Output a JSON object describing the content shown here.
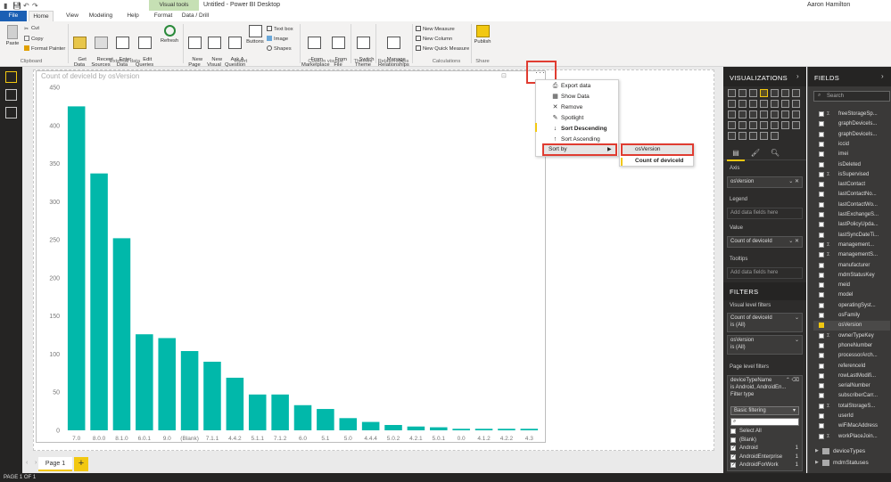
{
  "window": {
    "visual_tools_label": "Visual tools",
    "title": "Untitled - Power BI Desktop",
    "user": "Aaron Hamilton"
  },
  "tabs": [
    "File",
    "Home",
    "View",
    "Modeling",
    "Help",
    "Format",
    "Data / Drill"
  ],
  "ribbon": {
    "paste": "Paste",
    "cut": "Cut",
    "copy": "Copy",
    "format_painter": "Format Painter",
    "get_data": "Get\nData",
    "recent_sources": "Recent\nSources",
    "enter_data": "Enter\nData",
    "edit_queries": "Edit\nQueries",
    "refresh": "Refresh",
    "new_page": "New\nPage",
    "new_visual": "New\nVisual",
    "ask_question": "Ask A\nQuestion",
    "buttons": "Buttons",
    "text_box": "Text box",
    "image": "Image",
    "shapes": "Shapes",
    "from_marketplace": "From\nMarketplace",
    "from_file": "From\nFile",
    "switch_theme": "Switch\nTheme",
    "manage_relationships": "Manage\nRelationships",
    "new_measure": "New Measure",
    "new_column": "New Column",
    "new_quick_measure": "New Quick Measure",
    "publish": "Publish",
    "groups": {
      "clipboard": "Clipboard",
      "external_data": "External data",
      "insert": "Insert",
      "custom_visuals": "Custom visuals",
      "themes": "Themes",
      "relationships": "Relationships",
      "calculations": "Calculations",
      "share": "Share"
    }
  },
  "visual": {
    "title": "Count of deviceId by osVersion",
    "more_options": "···"
  },
  "context_menu": {
    "items": [
      "Export data",
      "Show Data",
      "Remove",
      "Spotlight",
      "Sort Descending",
      "Sort Ascending"
    ],
    "sort_by": "Sort by",
    "submenu": [
      "osVersion",
      "Count of deviceId"
    ]
  },
  "page_tabs": {
    "page1": "Page 1",
    "add": "+"
  },
  "status": "PAGE 1 OF 1",
  "visualizations": {
    "title": "VISUALIZATIONS",
    "axis_label": "Axis",
    "axis_value": "osVersion",
    "legend_label": "Legend",
    "legend_placeholder": "Add data fields here",
    "value_label": "Value",
    "value_value": "Count of deviceId",
    "tooltips_label": "Tooltips",
    "tooltips_placeholder": "Add data fields here"
  },
  "filters": {
    "title": "FILTERS",
    "visual_level": "Visual level filters",
    "f1_name": "Count of deviceId",
    "f1_state": "is (All)",
    "f2_name": "osVersion",
    "f2_state": "is (All)",
    "page_level": "Page level filters",
    "f3_name": "deviceTypeName",
    "f3_state": "is Android, AndroidEn...",
    "filter_type_label": "Filter type",
    "filter_type_value": "Basic filtering",
    "values": [
      {
        "label": "Select All",
        "count": "",
        "checked": false
      },
      {
        "label": "(Blank)",
        "count": "",
        "checked": false
      },
      {
        "label": "Android",
        "count": "1",
        "checked": true
      },
      {
        "label": "AndroidEnterprise",
        "count": "1",
        "checked": true
      },
      {
        "label": "AndroidForWork",
        "count": "1",
        "checked": true
      }
    ]
  },
  "fields": {
    "title": "FIELDS",
    "search_placeholder": "Search",
    "items": [
      {
        "name": "freeStorageSp...",
        "sigma": true,
        "checked": false
      },
      {
        "name": "graphDeviceIs...",
        "sigma": false,
        "checked": false
      },
      {
        "name": "graphDeviceIs...",
        "sigma": false,
        "checked": false
      },
      {
        "name": "iccid",
        "sigma": false,
        "checked": false
      },
      {
        "name": "imei",
        "sigma": false,
        "checked": false
      },
      {
        "name": "isDeleted",
        "sigma": false,
        "checked": false
      },
      {
        "name": "isSupervised",
        "sigma": true,
        "checked": false
      },
      {
        "name": "lastContact",
        "sigma": false,
        "checked": false
      },
      {
        "name": "lastContactNo...",
        "sigma": false,
        "checked": false
      },
      {
        "name": "lastContactWo...",
        "sigma": false,
        "checked": false
      },
      {
        "name": "lastExchangeS...",
        "sigma": false,
        "checked": false
      },
      {
        "name": "lastPolicyUpda...",
        "sigma": false,
        "checked": false
      },
      {
        "name": "lastSyncDateTi...",
        "sigma": false,
        "checked": false
      },
      {
        "name": "management...",
        "sigma": true,
        "checked": false
      },
      {
        "name": "managementS...",
        "sigma": true,
        "checked": false
      },
      {
        "name": "manufacturer",
        "sigma": false,
        "checked": false
      },
      {
        "name": "mdmStatusKey",
        "sigma": false,
        "checked": false
      },
      {
        "name": "meid",
        "sigma": false,
        "checked": false
      },
      {
        "name": "model",
        "sigma": false,
        "checked": false
      },
      {
        "name": "operatingSyst...",
        "sigma": false,
        "checked": false
      },
      {
        "name": "osFamily",
        "sigma": false,
        "checked": false
      },
      {
        "name": "osVersion",
        "sigma": false,
        "checked": true
      },
      {
        "name": "ownerTypeKey",
        "sigma": true,
        "checked": false
      },
      {
        "name": "phoneNumber",
        "sigma": false,
        "checked": false
      },
      {
        "name": "processorArch...",
        "sigma": false,
        "checked": false
      },
      {
        "name": "referenceId",
        "sigma": false,
        "checked": false
      },
      {
        "name": "rowLastModifi...",
        "sigma": false,
        "checked": false
      },
      {
        "name": "serialNumber",
        "sigma": false,
        "checked": false
      },
      {
        "name": "subscriberCarr...",
        "sigma": false,
        "checked": false
      },
      {
        "name": "totalStorageS...",
        "sigma": true,
        "checked": false
      },
      {
        "name": "userId",
        "sigma": false,
        "checked": false
      },
      {
        "name": "wiFiMacAddress",
        "sigma": false,
        "checked": false
      },
      {
        "name": "workPlaceJoin...",
        "sigma": true,
        "checked": false
      }
    ],
    "tables": [
      "deviceTypes",
      "mdmStatuses"
    ]
  },
  "chart_data": {
    "type": "bar",
    "title": "Count of deviceId by osVersion",
    "categories": [
      "7.0",
      "8.0.0",
      "8.1.0",
      "6.0.1",
      "9.0",
      "(Blank)",
      "7.1.1",
      "4.4.2",
      "5.1.1",
      "7.1.2",
      "6.0",
      "5.1",
      "5.0",
      "4.4.4",
      "5.0.2",
      "4.2.1",
      "5.0.1",
      "0.0",
      "4.1.2",
      "4.2.2",
      "4.3"
    ],
    "values": [
      425,
      337,
      252,
      126,
      121,
      104,
      90,
      69,
      47,
      47,
      33,
      28,
      16,
      11,
      7,
      5,
      4,
      2,
      2,
      2,
      2
    ],
    "yticks": [
      0,
      50,
      100,
      150,
      200,
      250,
      300,
      350,
      400,
      450
    ],
    "ylim": [
      0,
      450
    ],
    "color": "#01b8aa",
    "grid": false
  }
}
